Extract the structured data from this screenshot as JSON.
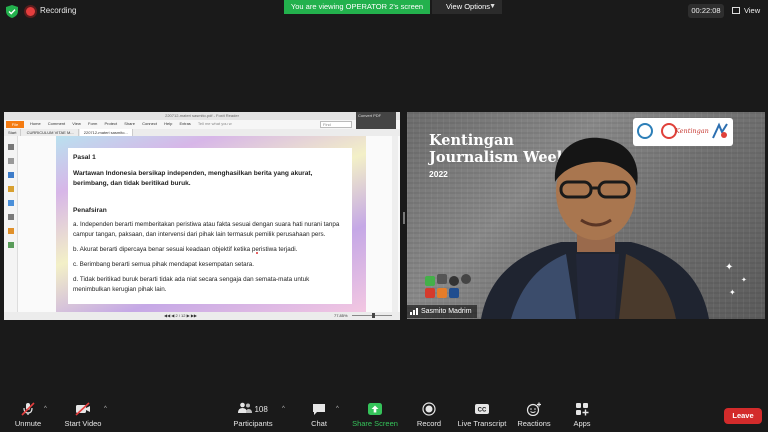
{
  "top_bar": {
    "recording_label": "Recording",
    "viewing_banner": "You are viewing OPERATOR 2's screen",
    "view_options_label": "View Options",
    "timer": "00:22:08",
    "view_label": "View"
  },
  "shared_screen": {
    "reader_title": "220712-materi sasmito.pdf - Foxit Reader",
    "file_button": "File",
    "menu": [
      "Home",
      "Comment",
      "View",
      "Form",
      "Protect",
      "Share",
      "Connect",
      "Help",
      "Extras"
    ],
    "tell_me": "Tell me what you w",
    "search_placeholder": "Find",
    "convert_label": "Convert PDF",
    "doc_tabs": [
      "Start",
      "CURRICULUM VITAE M...",
      "220712-materi sasmito..."
    ],
    "document": {
      "heading": "Pasal 1",
      "bold_statement": "Wartawan Indonesia bersikap independen, menghasilkan berita yang akurat, berimbang, dan tidak beritikad buruk.",
      "section_title": "Penafsiran",
      "items": [
        "a. Independen berarti memberitakan peristiwa atau fakta sesuai dengan suara hati nurani tanpa campur tangan, paksaan, dan intervensi dari pihak lain termasuk pemilik perusahaan pers.",
        "b. Akurat berarti dipercaya benar sesuai keadaan objektif ketika peristiwa terjadi.",
        "c. Berimbang berarti semua pihak mendapat kesempatan setara.",
        "d. Tidak beritikad buruk berarti tidak ada niat secara sengaja dan semata-mata untuk menimbulkan kerugian pihak lain."
      ]
    },
    "page_indicator": "2 / 12",
    "zoom": "77.85%",
    "zoom_fraction": 0.55
  },
  "video": {
    "event_title_line1": "Kentingan",
    "event_title_line2": "Journalism Week",
    "event_year": "2022",
    "logo_text": "Kentingan",
    "participant_name": "Sasmito Madrim"
  },
  "toolbar": {
    "unmute": "Unmute",
    "start_video": "Start Video",
    "participants": "Participants",
    "participants_count": "108",
    "chat": "Chat",
    "share_screen": "Share Screen",
    "record": "Record",
    "live_transcript": "Live Transcript",
    "reactions": "Reactions",
    "apps": "Apps",
    "leave": "Leave"
  },
  "colors": {
    "share_green": "#23b14d",
    "leave_red": "#d32b2b",
    "recording_red": "#e53e3e",
    "foxit_orange": "#f57c12"
  }
}
